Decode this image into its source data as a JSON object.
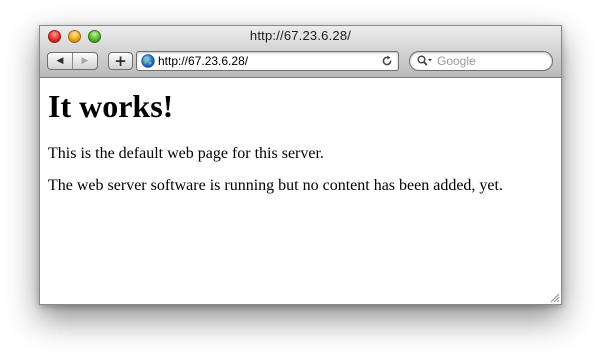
{
  "window": {
    "title": "http://67.23.6.28/"
  },
  "toolbar": {
    "back_label": "◀",
    "forward_label": "▶",
    "add_label": "+",
    "address_value": "http://67.23.6.28/",
    "search_placeholder": "Google"
  },
  "page": {
    "heading": "It works!",
    "paragraphs": [
      "This is the default web page for this server.",
      "The web server software is running but no content has been added, yet."
    ]
  },
  "colors": {
    "close": "#e2332a",
    "minimize": "#f0a91c",
    "zoom": "#56b92b",
    "globe": "#2f7ed8"
  },
  "icons": {
    "close": "close-icon",
    "minimize": "minimize-icon",
    "zoom": "zoom-icon",
    "back": "back-arrow-icon",
    "forward": "forward-arrow-icon",
    "add": "plus-icon",
    "site": "globe-icon",
    "reload": "reload-icon",
    "search": "magnifier-icon",
    "resize": "resize-grip-icon"
  }
}
